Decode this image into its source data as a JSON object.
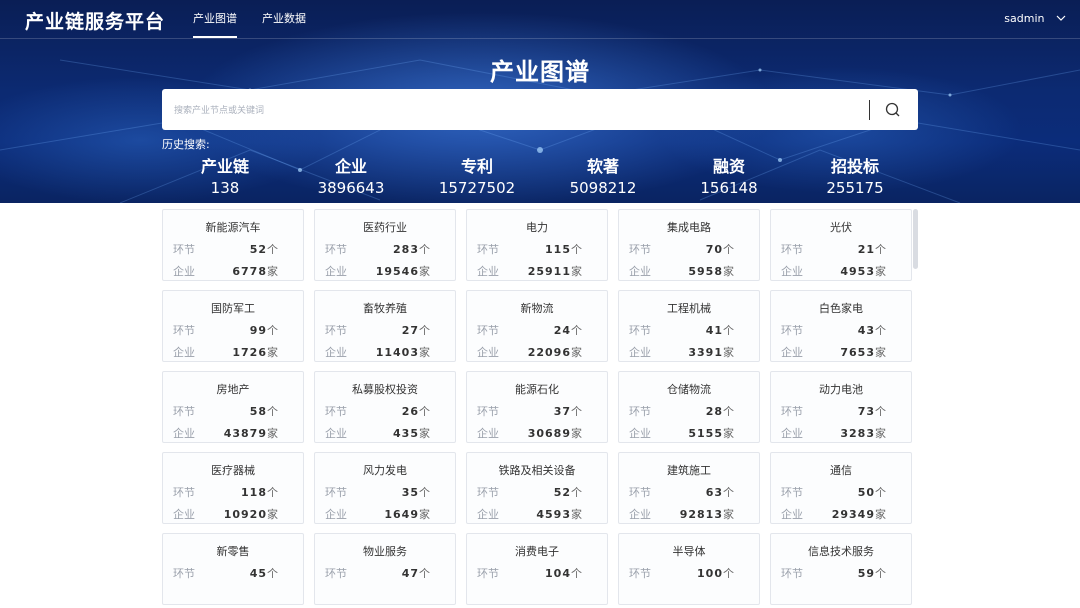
{
  "header": {
    "brand": "产业链服务平台",
    "nav": [
      {
        "label": "产业图谱",
        "active": true
      },
      {
        "label": "产业数据",
        "active": false
      }
    ],
    "user": "sadmin"
  },
  "hero": {
    "title": "产业图谱",
    "search_placeholder": "搜索产业节点或关键词",
    "history_label": "历史搜索:"
  },
  "stats": [
    {
      "label": "产业链",
      "value": "138"
    },
    {
      "label": "企业",
      "value": "3896643"
    },
    {
      "label": "专利",
      "value": "15727502"
    },
    {
      "label": "软著",
      "value": "5098212"
    },
    {
      "label": "融资",
      "value": "156148"
    },
    {
      "label": "招投标",
      "value": "255175"
    }
  ],
  "card_labels": {
    "node_key": "环节",
    "node_unit": "个",
    "company_key": "企业",
    "company_unit": "家"
  },
  "cards": [
    {
      "name": "新能源汽车",
      "nodes": "52",
      "companies": "6778"
    },
    {
      "name": "医药行业",
      "nodes": "283",
      "companies": "19546"
    },
    {
      "name": "电力",
      "nodes": "115",
      "companies": "25911"
    },
    {
      "name": "集成电路",
      "nodes": "70",
      "companies": "5958"
    },
    {
      "name": "光伏",
      "nodes": "21",
      "companies": "4953"
    },
    {
      "name": "国防军工",
      "nodes": "99",
      "companies": "1726"
    },
    {
      "name": "畜牧养殖",
      "nodes": "27",
      "companies": "11403"
    },
    {
      "name": "新物流",
      "nodes": "24",
      "companies": "22096"
    },
    {
      "name": "工程机械",
      "nodes": "41",
      "companies": "3391"
    },
    {
      "name": "白色家电",
      "nodes": "43",
      "companies": "7653"
    },
    {
      "name": "房地产",
      "nodes": "58",
      "companies": "43879"
    },
    {
      "name": "私募股权投资",
      "nodes": "26",
      "companies": "435"
    },
    {
      "name": "能源石化",
      "nodes": "37",
      "companies": "30689"
    },
    {
      "name": "仓储物流",
      "nodes": "28",
      "companies": "5155"
    },
    {
      "name": "动力电池",
      "nodes": "73",
      "companies": "3283"
    },
    {
      "name": "医疗器械",
      "nodes": "118",
      "companies": "10920"
    },
    {
      "name": "风力发电",
      "nodes": "35",
      "companies": "1649"
    },
    {
      "name": "铁路及相关设备",
      "nodes": "52",
      "companies": "4593"
    },
    {
      "name": "建筑施工",
      "nodes": "63",
      "companies": "92813"
    },
    {
      "name": "通信",
      "nodes": "50",
      "companies": "29349"
    },
    {
      "name": "新零售",
      "nodes": "45",
      "companies": ""
    },
    {
      "name": "物业服务",
      "nodes": "47",
      "companies": ""
    },
    {
      "name": "消费电子",
      "nodes": "104",
      "companies": ""
    },
    {
      "name": "半导体",
      "nodes": "100",
      "companies": ""
    },
    {
      "name": "信息技术服务",
      "nodes": "59",
      "companies": ""
    }
  ]
}
